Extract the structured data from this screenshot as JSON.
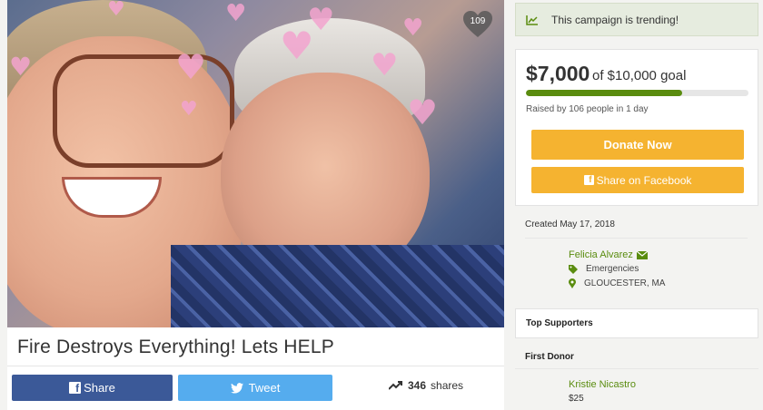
{
  "campaign": {
    "title": "Fire Destroys Everything! Lets HELP",
    "photo_heart_count": "109"
  },
  "social": {
    "share_label": "Share",
    "tweet_label": "Tweet",
    "shares_count": "346",
    "shares_label": "shares"
  },
  "trending": {
    "text": "This campaign is trending!",
    "icon": "trend-chart-icon"
  },
  "funding": {
    "raised": "$7,000",
    "goal_text": "of $10,000 goal",
    "progress_fraction": 0.7,
    "raised_by": "Raised by 106 people in 1 day",
    "donate_label": "Donate Now",
    "share_facebook_label": "Share on Facebook"
  },
  "details": {
    "created": "Created May 17, 2018",
    "organizer_name": "Felicia Alvarez",
    "category": "Emergencies",
    "location": "GLOUCESTER, MA"
  },
  "supporters": {
    "top_supporters_label": "Top Supporters",
    "first_donor_label": "First Donor",
    "first_donor_name": "Kristie Nicastro",
    "first_donor_amount": "$25"
  },
  "colors": {
    "brand_green": "#5a8c0f",
    "donate_orange": "#f5b330",
    "facebook_blue": "#3b5998",
    "twitter_blue": "#55acee"
  }
}
